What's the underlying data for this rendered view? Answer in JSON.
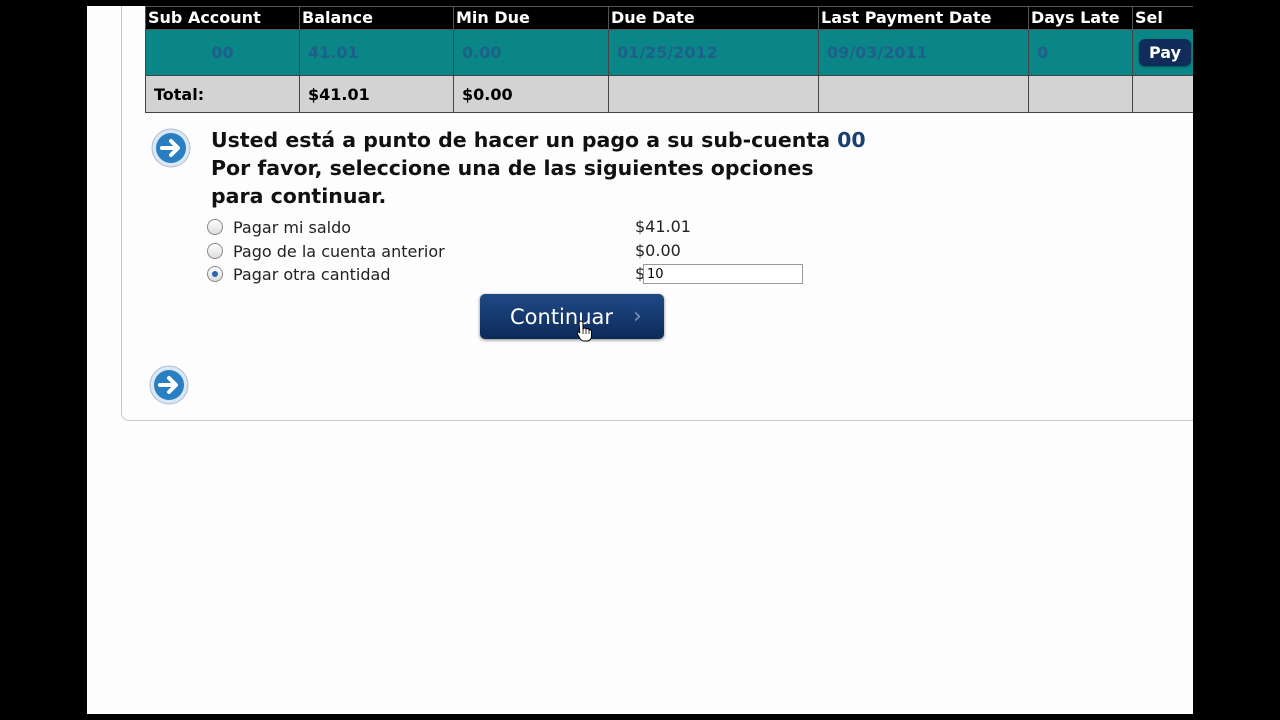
{
  "table": {
    "headers": [
      "Sub Account",
      "Balance",
      "Min Due",
      "Due Date",
      "Last Payment Date",
      "Days Late",
      "Sel"
    ],
    "row": {
      "sub_account": "00",
      "balance": "41.01",
      "min_due": "0.00",
      "due_date": "01/25/2012",
      "last_payment_date": "09/03/2011",
      "days_late": "0",
      "pay_button": "Pay"
    },
    "total": {
      "label": "Total:",
      "balance": "$41.01",
      "min_due": "$0.00"
    }
  },
  "prompt": {
    "line1_prefix": "Usted está a punto de hacer un pago a su sub-cuenta ",
    "account": "00",
    "line2": "Por favor, seleccione una de las siguientes opciones para continuar."
  },
  "options": [
    {
      "label": "Pagar mi saldo",
      "amount": "$41.01",
      "selected": false
    },
    {
      "label": "Pago de la cuenta anterior",
      "amount": "$0.00",
      "selected": false
    },
    {
      "label": "Pagar otra cantidad",
      "amount": "$",
      "selected": true
    }
  ],
  "other_amount_value": "10",
  "continue_label": "Continuar",
  "colors": {
    "row_bg": "#0a8686",
    "row_text": "#1e5f8c",
    "button_bg": "#0f2c5a",
    "arrow_blue": "#2a7fc2"
  },
  "icons": [
    "arrow-right-circle-icon",
    "chevron-right-icon",
    "hand-cursor-icon"
  ]
}
